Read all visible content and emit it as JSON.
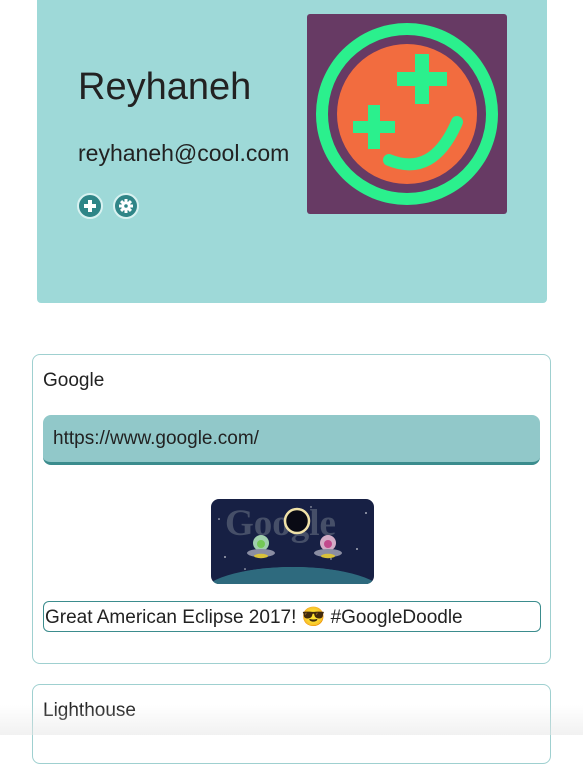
{
  "profile": {
    "name": "Reyhaneh",
    "email": "reyhaneh@cool.com",
    "actions": [
      {
        "icon": "plus-icon"
      },
      {
        "icon": "gear-icon"
      }
    ],
    "avatar_icon": "smiley-plus-avatar-icon"
  },
  "links": [
    {
      "title": "Google",
      "url": "https://www.google.com/",
      "image_text": "Google",
      "description": "Great American Eclipse 2017! 😎 #GoogleDoodle"
    },
    {
      "title": "Lighthouse"
    }
  ],
  "colors": {
    "profile_bg": "#9ed9d8",
    "accent": "#2f8587",
    "url_bg": "#91c8c9",
    "card_border": "#9fd0d0",
    "avatar_bg": "#673a64",
    "avatar_ring": "#2bf08d",
    "avatar_face": "#f26c3f"
  }
}
